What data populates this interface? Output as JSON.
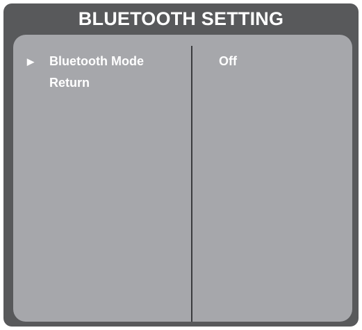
{
  "title": "BLUETOOTH SETTING",
  "menu": {
    "items": [
      {
        "label": "Bluetooth Mode",
        "selected": true,
        "pointer_icon": "triangle-right-icon"
      },
      {
        "label": "Return",
        "selected": false
      }
    ]
  },
  "values": {
    "bluetooth_mode": "Off"
  },
  "colors": {
    "frame": "#58595b",
    "panel": "#a6a7ab",
    "text": "#ffffff",
    "divider": "#3a3b3d"
  }
}
